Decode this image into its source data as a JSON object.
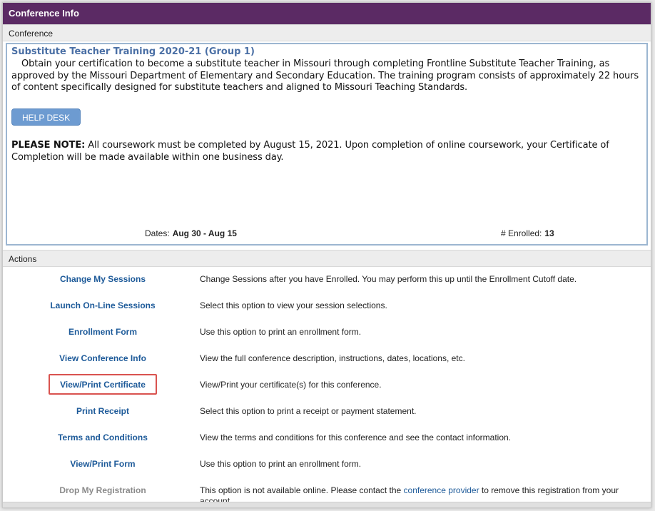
{
  "window": {
    "title": "Conference Info"
  },
  "conference_section": {
    "label": "Conference"
  },
  "conference": {
    "title": "Substitute Teacher Training 2020-21 (Group 1)",
    "description": "Obtain your certification to become a substitute teacher in Missouri through completing Frontline Substitute Teacher Training, as approved by the Missouri Department of Elementary and Secondary Education. The training program consists of approximately 22 hours of content specifically designed for substitute teachers and aligned to Missouri Teaching Standards.",
    "help_button": "HELP DESK",
    "note_label": "PLEASE NOTE:",
    "note_text": " All coursework must be completed by August 15, 2021. Upon completion of online coursework, your Certificate of Completion will be made available within one business day.",
    "dates_label": "Dates:",
    "dates_value": "Aug 30 - Aug 15",
    "enrolled_label": "# Enrolled:",
    "enrolled_value": "13"
  },
  "actions_section": {
    "label": "Actions"
  },
  "actions": [
    {
      "label": "Change My Sessions",
      "description": "Change Sessions after you have Enrolled. You may perform this up until the Enrollment Cutoff date."
    },
    {
      "label": "Launch On-Line Sessions",
      "description": "Select this option to view your session selections."
    },
    {
      "label": "Enrollment Form",
      "description": "Use this option to print an enrollment form."
    },
    {
      "label": "View Conference Info",
      "description": "View the full conference description, instructions, dates, locations, etc."
    },
    {
      "label": "View/Print Certificate",
      "description": "View/Print your certificate(s) for this conference."
    },
    {
      "label": "Print Receipt",
      "description": "Select this option to print a receipt or payment statement."
    },
    {
      "label": "Terms and Conditions",
      "description": "View the terms and conditions for this conference and see the contact information."
    },
    {
      "label": "View/Print Form",
      "description": "Use this option to print an enrollment form."
    },
    {
      "label": "Drop My Registration",
      "description_pre": "This option is not available online. Please contact the ",
      "description_link": "conference provider",
      "description_post": " to remove this registration from your account."
    }
  ],
  "colors": {
    "title_bar": "#5b2a64",
    "link": "#1d5a99",
    "help_button": "#6d9bd1",
    "highlight": "#d9534f"
  }
}
